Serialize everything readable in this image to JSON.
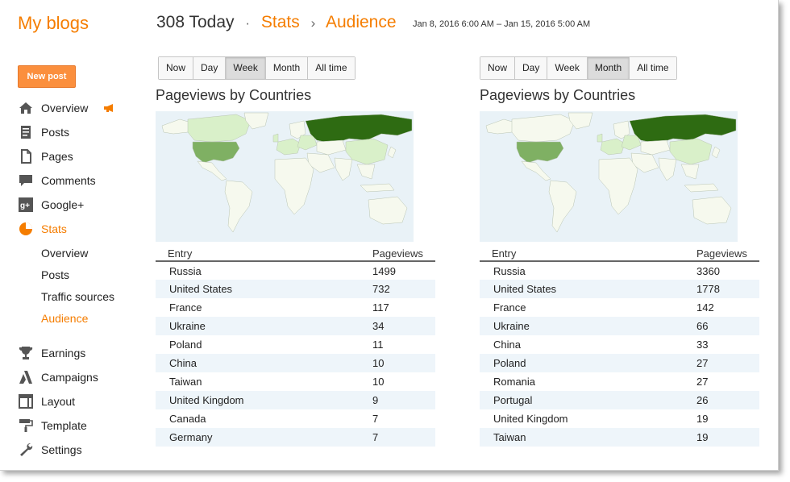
{
  "sidebar": {
    "brand": "My blogs",
    "new_post": "New post",
    "items": [
      {
        "label": "Overview",
        "icon": "home-icon"
      },
      {
        "label": "Posts",
        "icon": "posts-icon"
      },
      {
        "label": "Pages",
        "icon": "pages-icon"
      },
      {
        "label": "Comments",
        "icon": "comments-icon"
      },
      {
        "label": "Google+",
        "icon": "google-plus-icon"
      },
      {
        "label": "Stats",
        "icon": "pie-chart-icon"
      },
      {
        "label": "Earnings",
        "icon": "trophy-icon"
      },
      {
        "label": "Campaigns",
        "icon": "adwords-icon"
      },
      {
        "label": "Layout",
        "icon": "layout-icon"
      },
      {
        "label": "Template",
        "icon": "paint-roller-icon"
      },
      {
        "label": "Settings",
        "icon": "wrench-icon"
      }
    ],
    "stats_sub": [
      {
        "label": "Overview"
      },
      {
        "label": "Posts"
      },
      {
        "label": "Traffic sources"
      },
      {
        "label": "Audience"
      }
    ]
  },
  "header": {
    "today": "308 Today",
    "dot": "·",
    "crumb_stats": "Stats",
    "chevron": "›",
    "crumb_audience": "Audience",
    "daterange": "Jan 8, 2016 6:00 AM – Jan 15, 2016 5:00 AM"
  },
  "colors": {
    "accent": "#f57d00",
    "map_top": "#2e6b12",
    "map_mid": "#7fb063",
    "map_low": "#d9f0c9",
    "map_none": "#f6f9ee",
    "water": "#e9f2f7"
  },
  "panels": [
    {
      "tabs": [
        "Now",
        "Day",
        "Week",
        "Month",
        "All time"
      ],
      "selected": "Week",
      "title": "Pageviews by Countries",
      "col_entry": "Entry",
      "col_pageviews": "Pageviews",
      "rows": [
        {
          "entry": "Russia",
          "pageviews": "1499"
        },
        {
          "entry": "United States",
          "pageviews": "732"
        },
        {
          "entry": "France",
          "pageviews": "117"
        },
        {
          "entry": "Ukraine",
          "pageviews": "34"
        },
        {
          "entry": "Poland",
          "pageviews": "11"
        },
        {
          "entry": "China",
          "pageviews": "10"
        },
        {
          "entry": "Taiwan",
          "pageviews": "10"
        },
        {
          "entry": "United Kingdom",
          "pageviews": "9"
        },
        {
          "entry": "Canada",
          "pageviews": "7"
        },
        {
          "entry": "Germany",
          "pageviews": "7"
        }
      ]
    },
    {
      "tabs": [
        "Now",
        "Day",
        "Week",
        "Month",
        "All time"
      ],
      "selected": "Month",
      "title": "Pageviews by Countries",
      "col_entry": "Entry",
      "col_pageviews": "Pageviews",
      "rows": [
        {
          "entry": "Russia",
          "pageviews": "3360"
        },
        {
          "entry": "United States",
          "pageviews": "1778"
        },
        {
          "entry": "France",
          "pageviews": "142"
        },
        {
          "entry": "Ukraine",
          "pageviews": "66"
        },
        {
          "entry": "China",
          "pageviews": "33"
        },
        {
          "entry": "Poland",
          "pageviews": "27"
        },
        {
          "entry": "Romania",
          "pageviews": "27"
        },
        {
          "entry": "Portugal",
          "pageviews": "26"
        },
        {
          "entry": "United Kingdom",
          "pageviews": "19"
        },
        {
          "entry": "Taiwan",
          "pageviews": "19"
        }
      ]
    }
  ]
}
